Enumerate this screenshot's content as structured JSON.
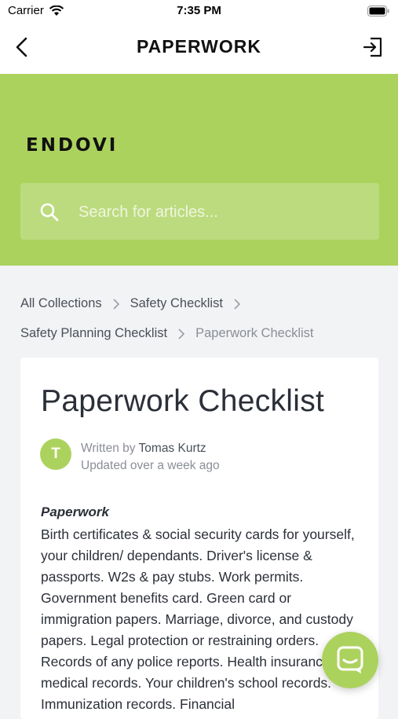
{
  "status_bar": {
    "carrier": "Carrier",
    "time": "7:35 PM"
  },
  "nav": {
    "title": "PAPERWORK"
  },
  "header": {
    "brand": "ENDOVI",
    "search_placeholder": "Search for articles...",
    "color": "#acd25e"
  },
  "breadcrumbs": {
    "items": [
      "All Collections",
      "Safety Checklist",
      "Safety Planning Checklist"
    ],
    "current": "Paperwork Checklist"
  },
  "article": {
    "title": "Paperwork Checklist",
    "author_initial": "T",
    "written_by_label": "Written by",
    "author": "Tomas Kurtz",
    "updated": "Updated over a week ago",
    "section_heading": "Paperwork",
    "body": "Birth certificates & social security cards for yourself, your children/ dependants. Driver's license & passports. W2s & pay stubs. Work permits. Government benefits card. Green card or immigration papers. Marriage, divorce, and custody papers. Legal protection or restraining orders. Records of any police reports. Health insurance & medical records. Your children's school records. Immunization records. Financial"
  },
  "icons": [
    "back-icon",
    "exit-icon",
    "wifi-icon",
    "battery-icon",
    "search-icon",
    "chevron-right-icon",
    "chat-icon"
  ]
}
